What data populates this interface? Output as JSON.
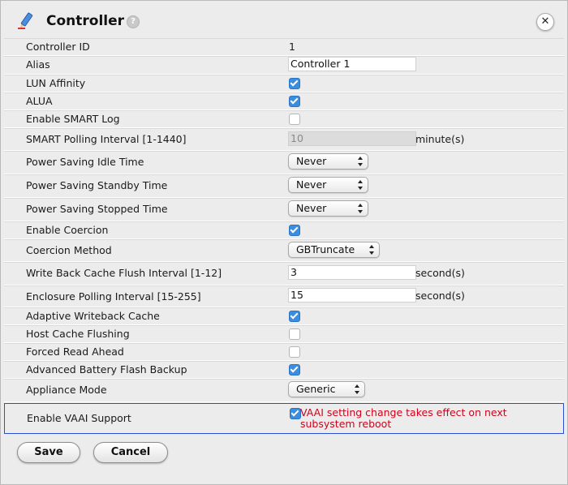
{
  "dialog": {
    "title": "Controller",
    "help_icon": "question-icon",
    "close_icon": "close-icon",
    "title_icon": "pencil-icon"
  },
  "fields": {
    "controller_id": {
      "label": "Controller ID",
      "value": "1"
    },
    "alias": {
      "label": "Alias",
      "value": "Controller 1"
    },
    "lun_affinity": {
      "label": "LUN Affinity",
      "checked": true
    },
    "alua": {
      "label": "ALUA",
      "checked": true
    },
    "enable_smart_log": {
      "label": "Enable SMART Log",
      "checked": false
    },
    "smart_polling": {
      "label": "SMART Polling Interval [1-1440]",
      "value": "10",
      "unit": "minute(s)",
      "disabled": true
    },
    "ps_idle": {
      "label": "Power Saving Idle Time",
      "value": "Never"
    },
    "ps_standby": {
      "label": "Power Saving Standby Time",
      "value": "Never"
    },
    "ps_stopped": {
      "label": "Power Saving Stopped Time",
      "value": "Never"
    },
    "enable_coercion": {
      "label": "Enable Coercion",
      "checked": true
    },
    "coercion_method": {
      "label": "Coercion Method",
      "value": "GBTruncate"
    },
    "wb_flush": {
      "label": "Write Back Cache Flush Interval [1-12]",
      "value": "3",
      "unit": "second(s)"
    },
    "enc_polling": {
      "label": "Enclosure Polling Interval [15-255]",
      "value": "15",
      "unit": "second(s)"
    },
    "adaptive_wb": {
      "label": "Adaptive Writeback Cache",
      "checked": true
    },
    "host_cache_flush": {
      "label": "Host Cache Flushing",
      "checked": false
    },
    "forced_read_ahead": {
      "label": "Forced Read Ahead",
      "checked": false
    },
    "adv_battery": {
      "label": "Advanced Battery Flash Backup",
      "checked": true
    },
    "appliance_mode": {
      "label": "Appliance Mode",
      "value": "Generic"
    },
    "vaai": {
      "label": "Enable VAAI Support",
      "checked": true,
      "note": "VAAI setting change takes effect on next subsystem reboot"
    }
  },
  "buttons": {
    "save": "Save",
    "cancel": "Cancel"
  },
  "colors": {
    "accent": "#3b8de0",
    "warning": "#d0021b",
    "highlight_border": "#2a4fd6"
  }
}
